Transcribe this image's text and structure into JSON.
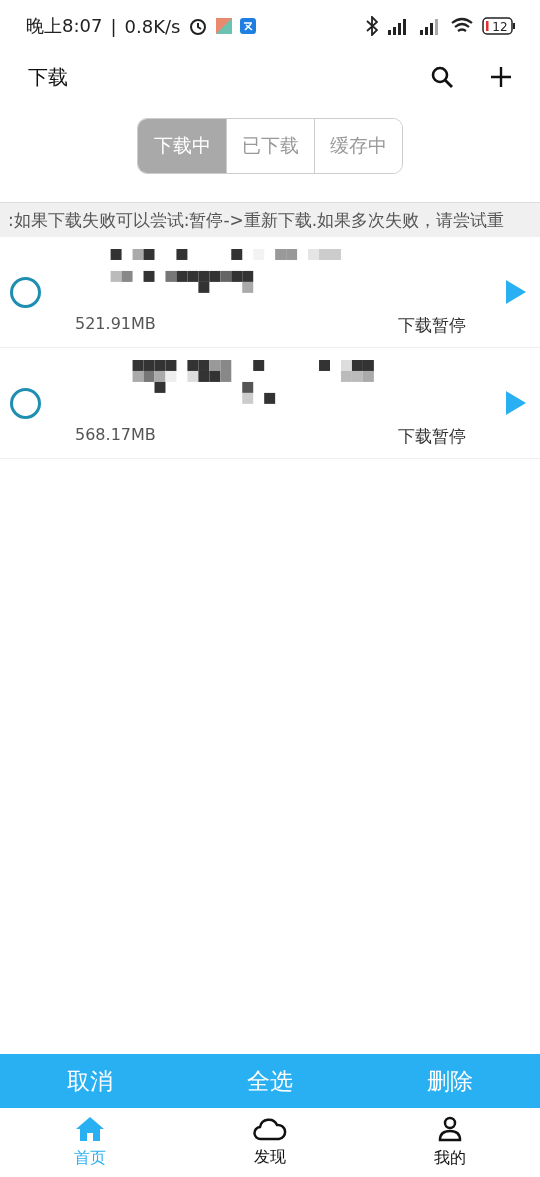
{
  "status_bar": {
    "time": "晚上8:07",
    "separator": "|",
    "speed": "0.8K/s",
    "battery": "12"
  },
  "header": {
    "title": "下载"
  },
  "tabs": [
    {
      "label": "下载中",
      "selected": true
    },
    {
      "label": "已下载",
      "selected": false
    },
    {
      "label": "缓存中",
      "selected": false
    }
  ],
  "notice": ":如果下载失败可以尝试:暂停->重新下载.如果多次失败，请尝试重",
  "downloads": [
    {
      "size": "521.91MB",
      "status": "下载暂停",
      "checked": false
    },
    {
      "size": "568.17MB",
      "status": "下载暂停",
      "checked": false
    }
  ],
  "actions": [
    "取消",
    "全选",
    "删除"
  ],
  "nav": [
    {
      "label": "首页",
      "kind": "home",
      "selected": true
    },
    {
      "label": "发现",
      "kind": "cloud",
      "selected": false
    },
    {
      "label": "我的",
      "kind": "user",
      "selected": false
    }
  ]
}
